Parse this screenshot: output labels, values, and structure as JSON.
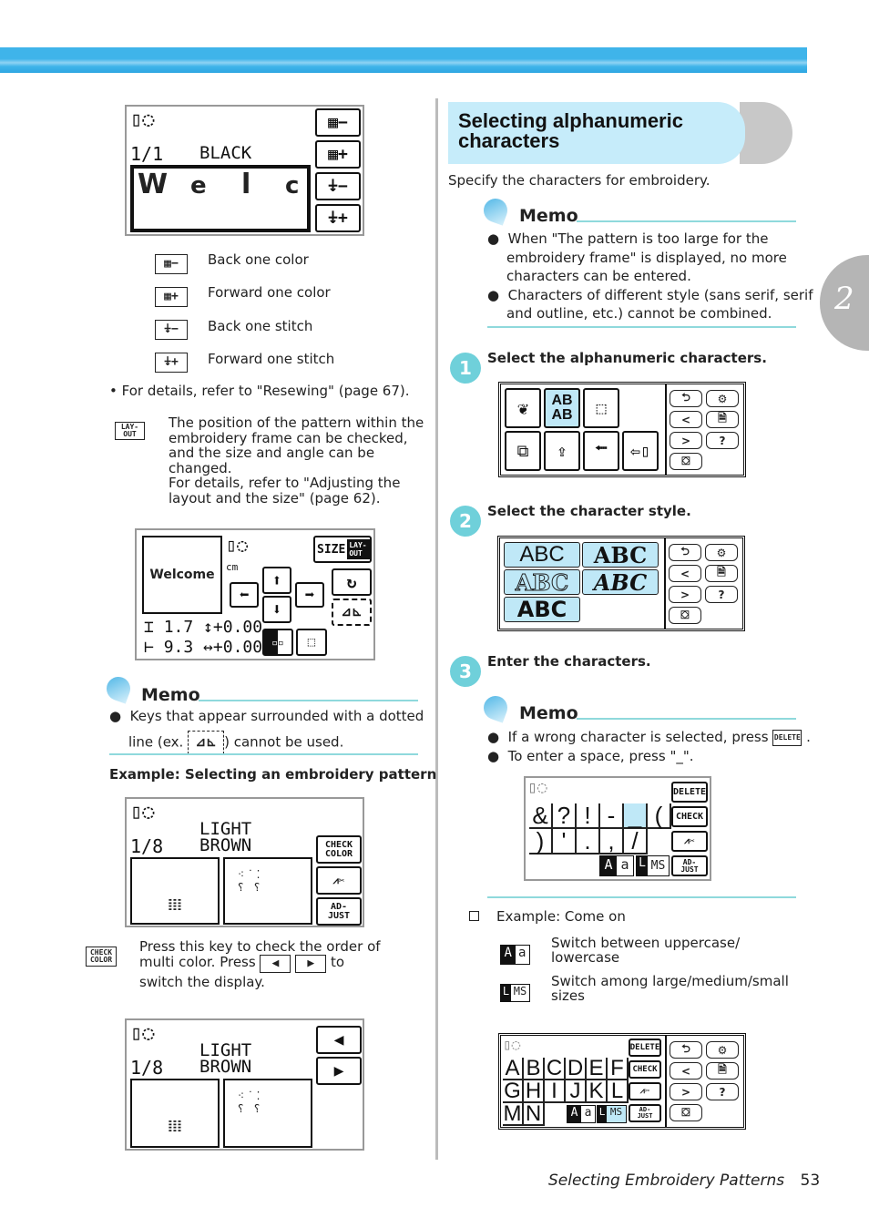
{
  "chapter_tab": "2",
  "left": {
    "screen1": {
      "fraction": "1/1",
      "color": "BLACK",
      "letters": [
        "W",
        "e",
        "l",
        "c"
      ]
    },
    "legend": [
      {
        "icon": "back-one-color-icon",
        "label": "Back one color"
      },
      {
        "icon": "forward-one-color-icon",
        "label": "Forward one color"
      },
      {
        "icon": "back-one-stitch-icon",
        "label": "Back one stitch"
      },
      {
        "icon": "forward-one-stitch-icon",
        "label": "Forward one stitch"
      }
    ],
    "details_note": "For details, refer to \"Resewing\" (page 67).",
    "layout_key_label": "LAY-OUT",
    "layout_text": [
      "The position of the pattern within the",
      "embroidery frame can be checked,",
      "and the size and angle can be",
      "changed.",
      "For details, refer to \"Adjusting the",
      "layout and the size\" (page 62)."
    ],
    "screen2": {
      "preview": "Welcome",
      "unit": "cm",
      "size_key": "SIZE",
      "layout_key": "LAY-OUT",
      "height_value": "1.7",
      "height_offset": "+0.00",
      "width_value": "9.3",
      "width_offset": "+0.00"
    },
    "memo": {
      "title": "Memo",
      "line1a": "Keys that appear surrounded with a dotted",
      "line1b_pre": "line (ex.",
      "line1b_post": ") cannot be used."
    },
    "example_heading": "Example: Selecting an embroidery pattern",
    "screen3": {
      "fraction": "1/8",
      "color_line1": "LIGHT",
      "color_line2": "BROWN",
      "check_key": "CHECK COLOR",
      "adjust_key": "AD- JUST"
    },
    "check_color_key": "CHECK COLOR",
    "check_text_1": "Press this key to check the order of",
    "check_text_2a": "multi color. Press",
    "check_text_2b": "to",
    "check_text_3": "switch the display.",
    "screen4": {
      "fraction": "1/8",
      "color_line1": "LIGHT",
      "color_line2": "BROWN"
    }
  },
  "right": {
    "section_title_1": "Selecting alphanumeric",
    "section_title_2": "characters",
    "intro": "Specify the characters for embroidery.",
    "memo1": {
      "title": "Memo",
      "items": [
        [
          "When \"The pattern is too large for the",
          "embroidery frame\" is displayed, no more",
          "characters can be entered."
        ],
        [
          "Characters of different style (sans serif, serif",
          "and outline, etc.) cannot be combined."
        ]
      ]
    },
    "steps": [
      {
        "num": "1",
        "text": "Select the alphanumeric characters."
      },
      {
        "num": "2",
        "text": "Select the character style."
      },
      {
        "num": "3",
        "text": "Enter the characters."
      }
    ],
    "category_screen": {
      "alpha_key": "AB AB"
    },
    "style_screen": {
      "styles": [
        "ABC",
        "ABC",
        "ABC",
        "ABC",
        "ABC"
      ]
    },
    "memo2": {
      "title": "Memo",
      "item1": "If a wrong character is selected, press",
      "item1_end": ".",
      "item2": "To enter a space, press \"_\".",
      "delete_key": "DELETE"
    },
    "symbol_screen": {
      "row1": [
        "&",
        "?",
        "!",
        "-",
        "_",
        "("
      ],
      "row2": [
        ")",
        "'",
        ".",
        ",",
        "/"
      ],
      "delete": "DELETE",
      "check": "CHECK",
      "case_upper": "A",
      "case_lower": "a",
      "size_l": "L",
      "size_ms": "MS",
      "adjust": "AD- JUST"
    },
    "example": "Example: Come on",
    "case_desc_1": "Switch between uppercase/",
    "case_desc_2": "lowercase",
    "size_desc_1": "Switch among large/medium/small",
    "size_desc_2": "sizes",
    "alpha_screen": {
      "row1": [
        "A",
        "B",
        "C",
        "D",
        "E",
        "F"
      ],
      "row2": [
        "G",
        "H",
        "I",
        "J",
        "K",
        "L"
      ],
      "row3": [
        "M",
        "N"
      ]
    }
  },
  "footer": {
    "title": "Selecting Embroidery Patterns",
    "page": "53"
  },
  "colors": {
    "accent_blue": "#3fb4ea",
    "key_highlight": "#bfe8f7",
    "memo_rule": "#8fd9dc",
    "step_badge": "#6fd0da"
  }
}
